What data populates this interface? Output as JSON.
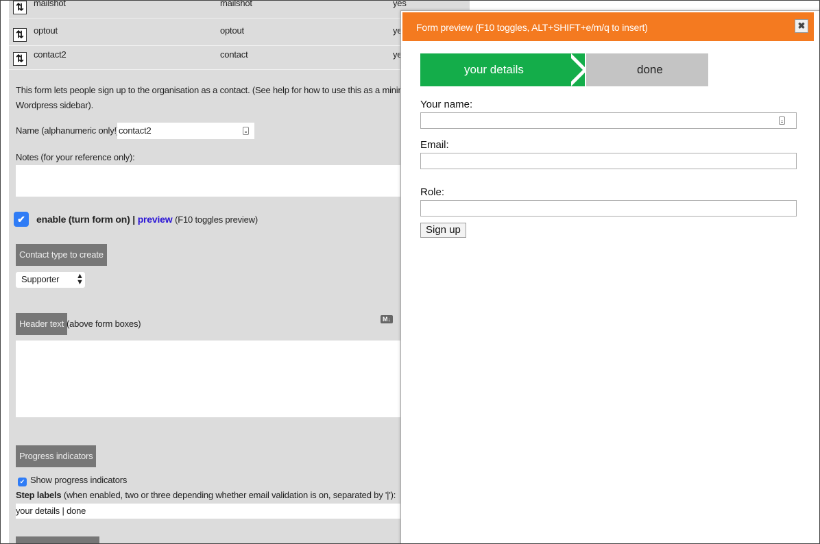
{
  "rows": [
    {
      "col1": "mailshot",
      "col2": "mailshot",
      "col3": "yes"
    },
    {
      "col1": "optout",
      "col2": "optout",
      "col3": "yes"
    },
    {
      "col1": "contact2",
      "col2": "contact",
      "col3": "yes"
    }
  ],
  "intro_text_line1": "This form lets people sign up to the organisation as a contact. (See help for how to use this as a minimal widg",
  "intro_text_line2": "Wordpress sidebar).",
  "name_label": "Name (alphanumeric only!):",
  "name_value": "contact2",
  "notes_label": "Notes (for your reference only):",
  "enable": {
    "label": "enable (turn form on)",
    "separator": "|",
    "preview_link": "preview",
    "hint": "(F10 toggles preview)"
  },
  "contact_type_button": "Contact type to create",
  "contact_type_select": "Supporter",
  "header_text_button": "Header text",
  "header_text_hint": "(above form boxes)",
  "markdown_badge": "M↓",
  "progress_button": "Progress indicators",
  "show_progress_label": "Show progress indicators",
  "step_labels_bold": "Step labels",
  "step_labels_hint": "(when enabled, two or three depending whether email validation is on, separated by '|'):",
  "step_labels_value": "your details | done",
  "preview": {
    "title": "Form preview (F10 toggles, ALT+SHIFT+e/m/q to insert)",
    "close": "✖",
    "step1": "your details",
    "step2": "done",
    "name_label": "Your name:",
    "email_label": "Email:",
    "role_label": "Role:",
    "submit": "Sign up"
  },
  "colors": {
    "accent": "#f47a20",
    "step_active": "#14ad4a",
    "step_inactive": "#c4c4c4",
    "link": "#2a14d6",
    "checkbox": "#2f7cf6"
  }
}
